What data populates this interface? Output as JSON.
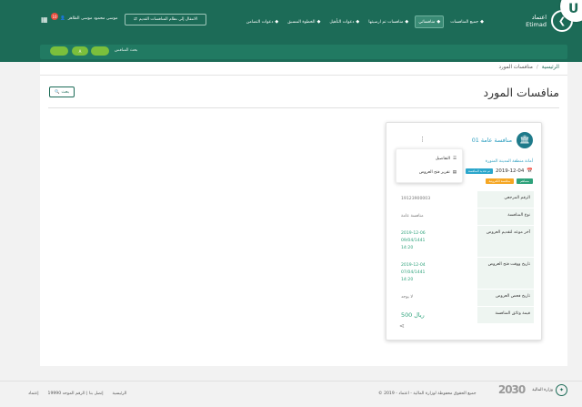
{
  "header": {
    "logo_text": "اعتماد",
    "logo_sub": "Etimad",
    "corner_badge": "U",
    "nav": [
      {
        "label": "جميع المنافسات",
        "active": false
      },
      {
        "label": "منافساتي",
        "active": true
      },
      {
        "label": "منافسات تم ارسيتها",
        "active": false
      },
      {
        "label": "دعوات التأهيل",
        "active": false
      },
      {
        "label": "الخطوة المسبق",
        "active": false
      },
      {
        "label": "دعوات التضامن",
        "active": false
      }
    ],
    "old_system_button": "الانتقال إلى نظام المنافسات القديم",
    "user_name": "موسى محمود موسى الظاهر",
    "notification_count": "10"
  },
  "subbar": {
    "pills": [
      "",
      "A",
      ""
    ],
    "label": "بحث المنافس"
  },
  "breadcrumb": {
    "home": "الرئيسية",
    "current": "منافسات المورد"
  },
  "page_title": "منافسات المورد",
  "search_button": "بحث",
  "card": {
    "title": "منافسة عامة 01",
    "menu": {
      "details": "التفاصيل",
      "report": "تقرير فتح العروض"
    },
    "agency": "أمانة منطقة المدينة المنورة",
    "date": "2019-12-04",
    "date_tag": "تم تحديد المنافسة",
    "tags": [
      "مساهم",
      "منافسة الكترونية"
    ],
    "info": [
      {
        "key": "الرقم المرجعي",
        "value": "19123900003",
        "style": "plain"
      },
      {
        "key": "نوع المنافسة",
        "value": "منافسة عامة",
        "style": "plain"
      },
      {
        "key": "آخر موعد لتقديم العروض",
        "value": "2019-12-06\n09/04/1441\n14:20",
        "style": "green"
      },
      {
        "key": "تاريخ ووقت فتح العروض",
        "value": "2019-12-04\n07/04/1441\n14:20",
        "style": "green"
      },
      {
        "key": "تاريخ فحص العروض",
        "value": "لا يوجد",
        "style": "plain"
      },
      {
        "key": "قيمة وثائق المنافسة",
        "value": "500 ريال",
        "style": "price"
      }
    ]
  },
  "footer": {
    "copyright": "© جميع الحقوق محفوظة لوزارة المالية - اعتماد - 2019",
    "links": [
      "الرئيسية",
      "إتصل بنا | الرقم الموحد 19990",
      "إعتماد"
    ],
    "mof": "وزارة المالية",
    "vision": "2030"
  }
}
